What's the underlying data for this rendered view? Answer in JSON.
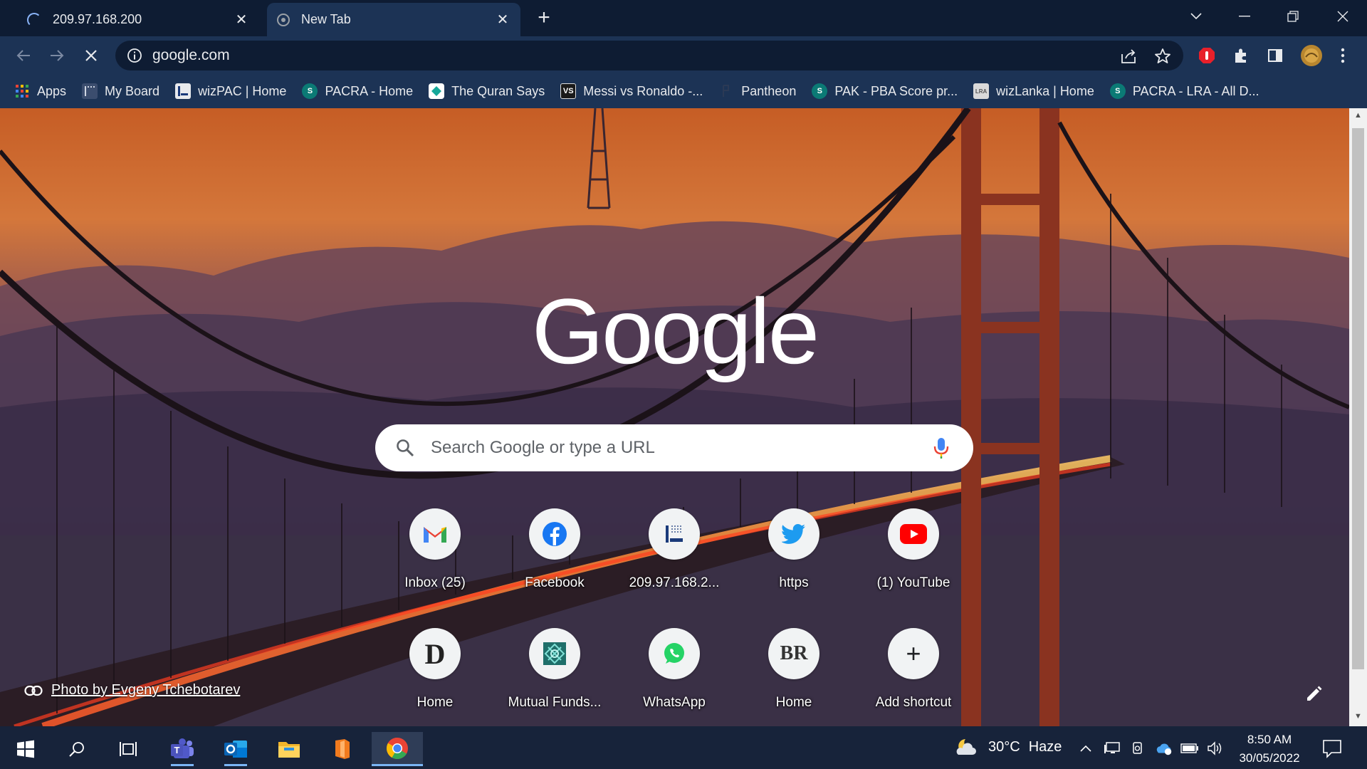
{
  "tabs": [
    {
      "title": "209.97.168.200",
      "loading": true
    },
    {
      "title": "New Tab",
      "active": true
    }
  ],
  "toolbar": {
    "url": "google.com"
  },
  "bookmarks": [
    {
      "label": "Apps",
      "icon": "apps-grid-icon"
    },
    {
      "label": "My Board",
      "icon": "board-icon"
    },
    {
      "label": "wizPAC | Home",
      "icon": "wizpac-icon"
    },
    {
      "label": "PACRA - Home",
      "icon": "sharepoint-icon"
    },
    {
      "label": "The Quran Says",
      "icon": "quran-icon"
    },
    {
      "label": "Messi vs Ronaldo -...",
      "icon": "vs-icon"
    },
    {
      "label": "Pantheon",
      "icon": "pantheon-icon"
    },
    {
      "label": "PAK - PBA Score pr...",
      "icon": "sharepoint-icon"
    },
    {
      "label": "wizLanka | Home",
      "icon": "wizlanka-icon"
    },
    {
      "label": "PACRA - LRA - All D...",
      "icon": "sharepoint-icon"
    }
  ],
  "page": {
    "logo": "Google",
    "search_placeholder": "Search Google or type a URL",
    "shortcuts_row1": [
      {
        "label": "Inbox (25)",
        "icon": "gmail-icon"
      },
      {
        "label": "Facebook",
        "icon": "facebook-icon"
      },
      {
        "label": "209.97.168.2...",
        "icon": "site-icon"
      },
      {
        "label": "https",
        "icon": "twitter-icon"
      },
      {
        "label": "(1) YouTube",
        "icon": "youtube-icon"
      }
    ],
    "shortcuts_row2": [
      {
        "label": "Home",
        "icon": "d-letter-icon",
        "glyph": "D"
      },
      {
        "label": "Mutual Funds...",
        "icon": "mutual-funds-icon"
      },
      {
        "label": "WhatsApp",
        "icon": "whatsapp-icon"
      },
      {
        "label": "Home",
        "icon": "br-letter-icon",
        "glyph": "BR"
      },
      {
        "label": "Add shortcut",
        "icon": "plus-icon",
        "glyph": "+"
      }
    ],
    "photo_credit": "Photo by Evgeny Tchebotarev"
  },
  "taskbar": {
    "temperature": "30°C",
    "weather": "Haze",
    "time": "8:50 AM",
    "date": "30/05/2022"
  },
  "colors": {
    "tabstrip_bg": "#0e1c33",
    "toolbar_bg": "#1c3355",
    "taskbar_bg": "#17233a",
    "accent": "#8ab4f8"
  }
}
